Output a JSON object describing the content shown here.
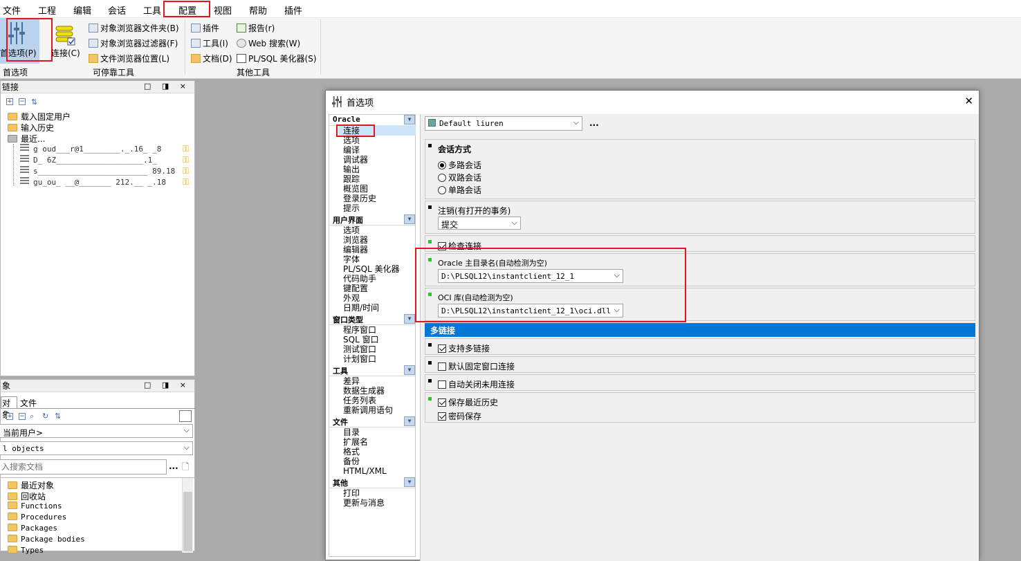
{
  "menubar": {
    "items": [
      "文件",
      "工程",
      "编辑",
      "会话",
      "工具",
      "配置",
      "视图",
      "帮助",
      "插件"
    ]
  },
  "ribbon": {
    "preferences_label": "首选项(P)",
    "connect_label": "连接(C)",
    "dockable_items": [
      "对象浏览器文件夹(B)",
      "对象浏览器过滤器(F)",
      "文件浏览器位置(L)"
    ],
    "other_col1": [
      "插件",
      "工具(I)",
      "文档(D)"
    ],
    "other_col2": [
      "报告(r)",
      "Web 搜索(W)",
      "PL/SQL 美化器(S)"
    ],
    "group_labels": [
      "首选项",
      "可停靠工具",
      "其他工具"
    ]
  },
  "connections_panel": {
    "title": "链接",
    "buttons": "□ ◨ ×",
    "tree": [
      "载入固定用户",
      "输入历史",
      "最近..."
    ],
    "recent": [
      "g  oud___r@1________._.16_ _8",
      "D_ 6Z___________________.1_",
      "s________________________ 89.18",
      "gu_ou_ __@_______ 212.__ _.18"
    ]
  },
  "objects_panel": {
    "title": "象",
    "buttons": "□ ◨ ×",
    "tabs": [
      "对象",
      "文件"
    ],
    "user_combo": "当前用户>",
    "filter_combo": "l objects",
    "search_placeholder": "入搜索文档",
    "ellipsis": "...",
    "tree": [
      "最近对象",
      "回收站",
      "Functions",
      "Procedures",
      "Packages",
      "Package bodies",
      "Types"
    ]
  },
  "dialog": {
    "title": "首选项",
    "close": "✕",
    "nav": [
      {
        "cat": "Oracle",
        "items": [
          "连接",
          "选项",
          "编译",
          "调试器",
          "输出",
          "跟踪",
          "概览图",
          "登录历史",
          "提示"
        ]
      },
      {
        "cat": "用户界面",
        "items": [
          "选项",
          "浏览器",
          "编辑器",
          "字体",
          "PL/SQL 美化器",
          "代码助手",
          "键配置",
          "外观",
          "日期/时间"
        ]
      },
      {
        "cat": "窗口类型",
        "items": [
          "程序窗口",
          "SQL 窗口",
          "测试窗口",
          "计划窗口"
        ]
      },
      {
        "cat": "工具",
        "items": [
          "差异",
          "数据生成器",
          "任务列表",
          "重新调用语句"
        ]
      },
      {
        "cat": "文件",
        "items": [
          "目录",
          "扩展名",
          "格式",
          "备份",
          "HTML/XML"
        ]
      },
      {
        "cat": "其他",
        "items": [
          "打印",
          "更新与消息"
        ]
      }
    ],
    "profile": "Default liuren",
    "profile_more": "...",
    "session_mode": {
      "title": "会话方式",
      "options": [
        "多路会话",
        "双路会话",
        "单路会话"
      ],
      "selected": "多路会话"
    },
    "logoff": {
      "label": "注销(有打开的事务)",
      "value": "提交"
    },
    "check_connection": "检查连接",
    "oracle_home": {
      "label": "Oracle 主目录名(自动检测为空)",
      "value": "D:\\PLSQL12\\instantclient_12_1"
    },
    "oci_lib": {
      "label": "OCI 库(自动检测为空)",
      "value": "D:\\PLSQL12\\instantclient_12_1\\oci.dll"
    },
    "multi_header": "多链接",
    "multi_options": [
      {
        "label": "支持多链接",
        "checked": true
      },
      {
        "label": "默认固定窗口连接",
        "checked": false
      },
      {
        "label": "自动关闭未用连接",
        "checked": false
      },
      {
        "label": "保存最近历史",
        "checked": true
      },
      {
        "label": "密码保存",
        "checked": true
      }
    ]
  },
  "colors": {
    "highlight": "#e3141b",
    "section_header": "#0078d7",
    "selected_nav": "#cce4f7"
  }
}
